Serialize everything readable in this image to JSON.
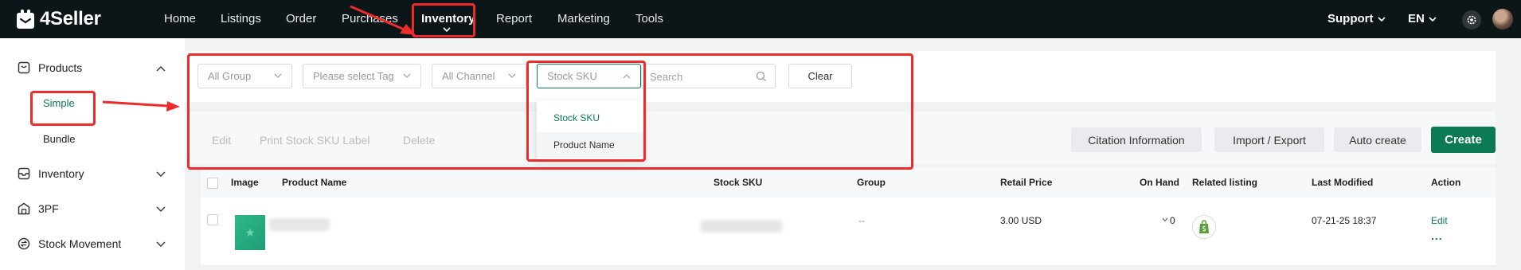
{
  "app": {
    "logo_text": "4Seller"
  },
  "nav": {
    "items": [
      "Home",
      "Listings",
      "Order",
      "Purchases",
      "Inventory",
      "Report",
      "Marketing",
      "Tools"
    ],
    "active": "Inventory",
    "support_label": "Support",
    "language": "EN"
  },
  "sidebar": {
    "products": {
      "label": "Products",
      "children": [
        "Simple",
        "Bundle"
      ],
      "active_child": "Simple"
    },
    "inventory_label": "Inventory",
    "tpf_label": "3PF",
    "stock_movement_label": "Stock Movement"
  },
  "filters": {
    "group_placeholder": "All Group",
    "tag_placeholder": "Please select Tag",
    "channel_placeholder": "All Channel",
    "search_type_value": "Stock SKU",
    "search_placeholder": "Search",
    "clear_label": "Clear",
    "search_type_options": [
      "Stock SKU",
      "Product Name"
    ]
  },
  "actions": {
    "edit": "Edit",
    "print_label": "Print Stock SKU Label",
    "delete": "Delete",
    "citation": "Citation Information",
    "import_export": "Import / Export",
    "auto_create": "Auto create",
    "create": "Create"
  },
  "table": {
    "headers": [
      "Image",
      "Product Name",
      "Stock SKU",
      "Group",
      "Retail Price",
      "On Hand",
      "Related listing",
      "Last Modified",
      "Action"
    ],
    "rows": [
      {
        "group": "--",
        "retail_price": "3.00 USD",
        "on_hand": "0",
        "last_modified": "07-21-25 18:37",
        "action": "Edit",
        "more": "..."
      }
    ]
  },
  "colors": {
    "brand_green": "#0b7a55",
    "topbar": "#0c1517",
    "annotation_red": "#ee2b2b"
  }
}
